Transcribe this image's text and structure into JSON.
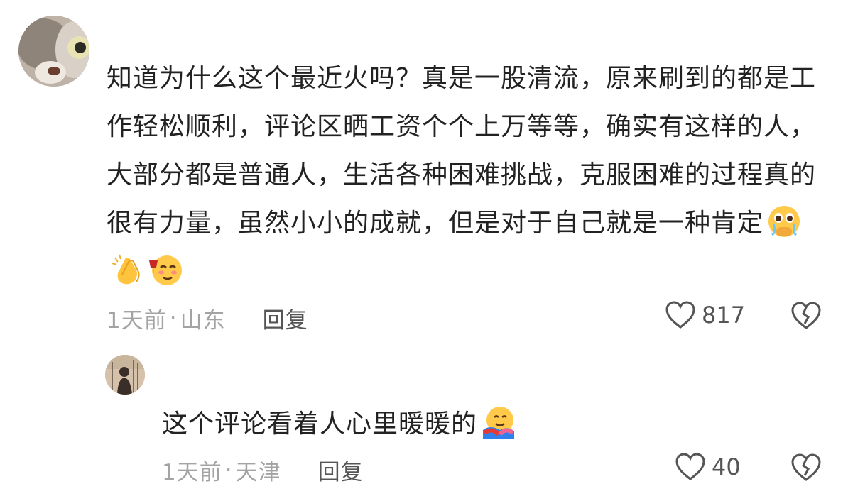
{
  "comment": {
    "text": "知道为什么这个最近火吗？真是一股清流，原来刷到的都是工作轻松顺利，评论区晒工资个个上万等等，确实有这样的人，大部分都是普通人，生活各种困难挑战，克服困难的过程真的很有力量，虽然小小的成就，但是对于自己就是一种肯定",
    "emojis": [
      "holding-back-tears-emoji",
      "clapping-hands-emoji",
      "toasting-emoji"
    ],
    "time": "1天前",
    "separator": "·",
    "location": "山东",
    "reply_label": "回复",
    "like_count": "817"
  },
  "reply": {
    "text": "这个评论看着人心里暖暖的",
    "emojis": [
      "hugging-face-emoji"
    ],
    "time": "1天前",
    "separator": "·",
    "location": "天津",
    "reply_label": "回复",
    "like_count": "40"
  }
}
